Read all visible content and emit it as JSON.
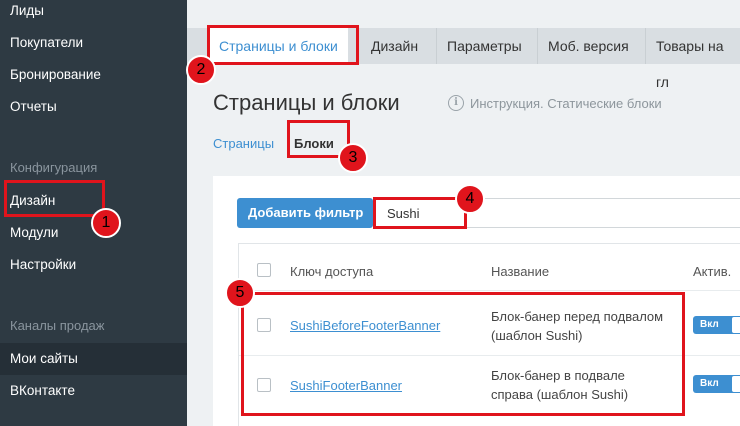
{
  "sidebar": {
    "items": [
      {
        "label": "Лиды"
      },
      {
        "label": "Покупатели"
      },
      {
        "label": "Бронирование"
      },
      {
        "label": "Отчеты"
      },
      {
        "label": "Дизайн"
      },
      {
        "label": "Модули"
      },
      {
        "label": "Настройки"
      },
      {
        "label": "Мои сайты"
      },
      {
        "label": "ВКонтакте"
      }
    ],
    "section_config": "Конфигурация",
    "section_channels": "Каналы продаж"
  },
  "tabs": [
    {
      "label": "Страницы и блоки"
    },
    {
      "label": "Дизайн"
    },
    {
      "label": "Параметры"
    },
    {
      "label": "Моб. версия"
    },
    {
      "label": "Товары на гл"
    }
  ],
  "page": {
    "title": "Страницы и блоки",
    "instruction": "Инструкция. Статические блоки",
    "subnav_pages": "Страницы",
    "subnav_blocks": "Блоки"
  },
  "filter": {
    "button_label": "Добавить фильтр",
    "search_value": "Sushi"
  },
  "table": {
    "headers": [
      "Ключ доступа",
      "Название",
      "Актив."
    ],
    "rows": [
      {
        "key": "SushiBeforeFooterBanner",
        "name": "Блок-банер перед подвалом (шаблон Sushi)",
        "active": "Вкл"
      },
      {
        "key": "SushiFooterBanner",
        "name": "Блок-банер в подвале справа (шаблон Sushi)",
        "active": "Вкл"
      }
    ]
  },
  "annotations": {
    "badges": [
      "1",
      "2",
      "3",
      "4",
      "5"
    ],
    "color": "#e0141c"
  }
}
